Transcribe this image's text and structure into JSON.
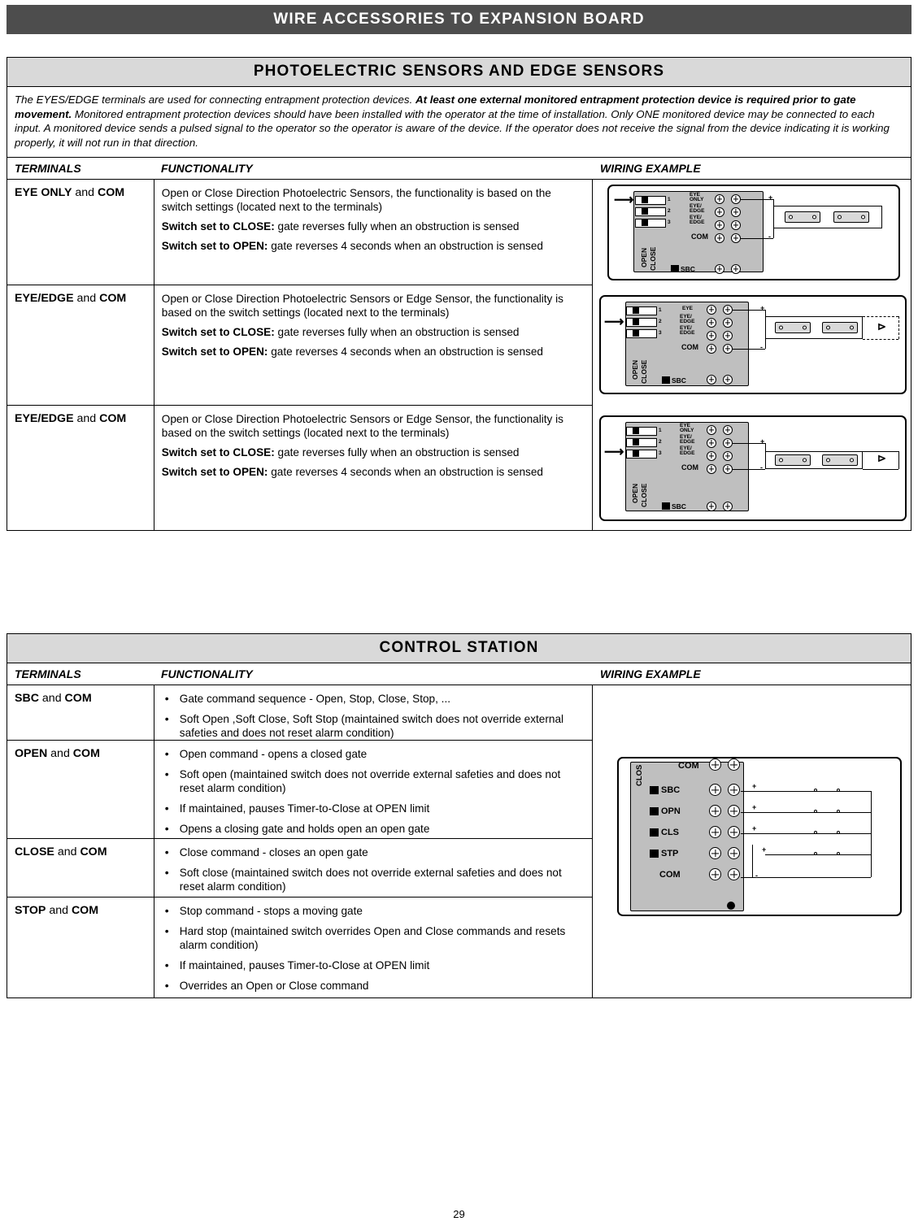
{
  "header": {
    "title": "WIRE ACCESSORIES TO EXPANSION BOARD"
  },
  "section1": {
    "title": "PHOTOELECTRIC SENSORS AND EDGE SENSORS",
    "intro_1": "The EYES/EDGE terminals are used for connecting entrapment protection devices. ",
    "intro_2": "At least one external monitored entrapment protection device is required prior to gate movement.",
    "intro_3": " Monitored entrapment protection devices should have been installed with the operator at the time of installation. Only ONE monitored device may be connected to each input. A monitored device sends a pulsed signal to the operator so the operator is aware of the device. If the operator does not receive the signal from the device indicating it is working properly, it will not run in that direction.",
    "columns": {
      "terminals": "TERMINALS",
      "functionality": "FUNCTIONALITY",
      "wiring": "WIRING EXAMPLE"
    },
    "rows": [
      {
        "terminal_bold_1": "EYE ONLY",
        "terminal_and": " and ",
        "terminal_bold_2": "COM",
        "line1": "Open or Close Direction Photoelectric Sensors, the functionality is based on the switch settings (located next to the terminals)",
        "line2_bold": "Switch set to CLOSE:",
        "line2": " gate reverses fully when an obstruction is sensed",
        "line3_bold": "Switch set to OPEN:",
        "line3": " gate reverses 4 seconds when an obstruction is sensed"
      },
      {
        "terminal_bold_1": "EYE/EDGE",
        "terminal_and": " and ",
        "terminal_bold_2": "COM",
        "line1": "Open or Close Direction Photoelectric Sensors or Edge Sensor, the functionality is based on the switch settings (located next to the terminals)",
        "line2_bold": "Switch set to CLOSE:",
        "line2": " gate reverses fully when an obstruction is sensed",
        "line3_bold": "Switch set to OPEN:",
        "line3": " gate reverses 4 seconds when an obstruction is sensed"
      },
      {
        "terminal_bold_1": "EYE/EDGE",
        "terminal_and": " and ",
        "terminal_bold_2": "COM",
        "line1": "Open or Close Direction Photoelectric Sensors or Edge Sensor, the functionality is based on the switch settings (located next to the terminals)",
        "line2_bold": "Switch set to CLOSE:",
        "line2": " gate reverses fully when an obstruction is sensed",
        "line3_bold": "Switch set to OPEN:",
        "line3": " gate reverses 4 seconds when an obstruction is sensed"
      }
    ],
    "diagrams": [
      {
        "id": "diagram-eye-only",
        "switch_label_open": "OPEN",
        "switch_label_close": "CLOSE",
        "terminal_labels": [
          "EYE\nONLY",
          "EYE/\nEDGE",
          "EYE/\nEDGE",
          "COM"
        ],
        "numbers": [
          "1",
          "2",
          "3"
        ],
        "sbc": "SBC",
        "polarity": [
          "+",
          "-"
        ]
      },
      {
        "id": "diagram-eye-edge-1",
        "switch_label_open": "OPEN",
        "switch_label_close": "CLOSE",
        "terminal_labels": [
          "EYE",
          "EYE/\nEDGE",
          "EYE/\nEDGE",
          "COM"
        ],
        "numbers": [
          "1",
          "2",
          "3"
        ],
        "sbc": "SBC",
        "polarity": [
          "+",
          "-"
        ]
      },
      {
        "id": "diagram-eye-edge-2",
        "switch_label_open": "OPEN",
        "switch_label_close": "CLOSE",
        "terminal_labels": [
          "EYE\nONLY",
          "EYE/\nEDGE",
          "EYE/\nEDGE",
          "COM"
        ],
        "numbers": [
          "1",
          "2",
          "3"
        ],
        "sbc": "SBC",
        "polarity": [
          "+",
          "-"
        ]
      }
    ]
  },
  "section2": {
    "title": "CONTROL STATION",
    "columns": {
      "terminals": "TERMINALS",
      "functionality": "FUNCTIONALITY",
      "wiring": "WIRING EXAMPLE"
    },
    "rows": [
      {
        "terminal_bold_1": "SBC",
        "terminal_and": " and ",
        "terminal_bold_2": "COM",
        "bullets": [
          "Gate command sequence - Open, Stop, Close, Stop, ...",
          "Soft Open ,Soft Close, Soft Stop (maintained switch does not override external safeties and does not reset alarm condition)"
        ]
      },
      {
        "terminal_bold_1": "OPEN",
        "terminal_and": " and ",
        "terminal_bold_2": "COM",
        "bullets": [
          "Open command - opens a closed gate",
          "Soft open (maintained switch does not override external safeties and does not reset alarm condition)",
          "If maintained, pauses Timer-to-Close at OPEN limit",
          "Opens a closing gate and holds open an open gate"
        ]
      },
      {
        "terminal_bold_1": "CLOSE",
        "terminal_and": " and ",
        "terminal_bold_2": "COM",
        "bullets": [
          "Close command - closes an open gate",
          "Soft close (maintained switch does not override external safeties and does not reset alarm condition)"
        ]
      },
      {
        "terminal_bold_1": "STOP",
        "terminal_and": " and ",
        "terminal_bold_2": "COM",
        "bullets": [
          "Stop command - stops a moving gate",
          "Hard stop (maintained switch overrides Open and Close commands and resets alarm condition)",
          "If maintained, pauses Timer-to-Close at OPEN limit",
          "Overrides an Open or Close command"
        ]
      }
    ],
    "diagram": {
      "id": "diagram-control-station",
      "side_label": "CLOS",
      "terminal_labels": [
        "COM",
        "SBC",
        "OPN",
        "CLS",
        "STP",
        "COM"
      ],
      "polarity": [
        "+",
        "+",
        "+",
        "+",
        "-"
      ]
    }
  },
  "footer": {
    "page_number": "29"
  }
}
